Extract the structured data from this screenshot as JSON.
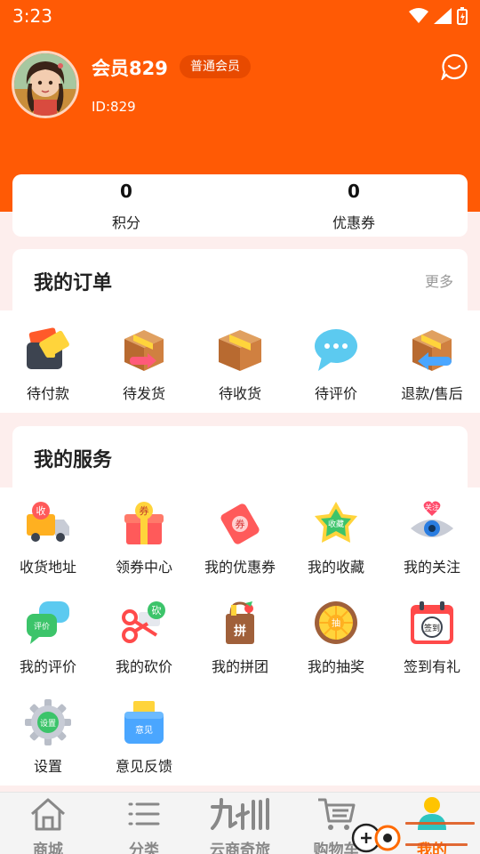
{
  "status": {
    "time": "3:23"
  },
  "profile": {
    "username": "会员829",
    "badge": "普通会员",
    "id_text": "ID:829"
  },
  "stats": [
    {
      "value": "0",
      "label": "积分"
    },
    {
      "value": "0",
      "label": "优惠券"
    }
  ],
  "orders": {
    "title": "我的订单",
    "more": "更多",
    "items": [
      {
        "label": "待付款",
        "icon": "wallet-icon"
      },
      {
        "label": "待发货",
        "icon": "box-send-icon"
      },
      {
        "label": "待收货",
        "icon": "box-icon"
      },
      {
        "label": "待评价",
        "icon": "chat-bubble-icon"
      },
      {
        "label": "退款/售后",
        "icon": "box-return-icon"
      }
    ]
  },
  "services": {
    "title": "我的服务",
    "items": [
      {
        "label": "收货地址",
        "icon": "delivery-truck-icon",
        "glyph": "收"
      },
      {
        "label": "领券中心",
        "icon": "gift-coupon-icon",
        "glyph": "券"
      },
      {
        "label": "我的优惠券",
        "icon": "ticket-icon",
        "glyph": "券"
      },
      {
        "label": "我的收藏",
        "icon": "favorite-icon",
        "glyph": "收藏"
      },
      {
        "label": "我的关注",
        "icon": "eye-follow-icon",
        "glyph": "关注"
      },
      {
        "label": "我的评价",
        "icon": "review-icon",
        "glyph": "评价"
      },
      {
        "label": "我的砍价",
        "icon": "scissors-icon",
        "glyph": "砍"
      },
      {
        "label": "我的拼团",
        "icon": "group-buy-icon",
        "glyph": "拼"
      },
      {
        "label": "我的抽奖",
        "icon": "lottery-icon",
        "glyph": "抽"
      },
      {
        "label": "签到有礼",
        "icon": "calendar-checkin-icon",
        "glyph": "签到"
      },
      {
        "label": "设置",
        "icon": "settings-gear-icon",
        "glyph": "设置"
      },
      {
        "label": "意见反馈",
        "icon": "feedback-icon",
        "glyph": "意见"
      }
    ]
  },
  "tabbar": [
    {
      "label": "商城",
      "icon": "home-icon"
    },
    {
      "label": "分类",
      "icon": "list-icon"
    },
    {
      "label": "云商奇旅",
      "icon": "jiuzhou-logo-icon"
    },
    {
      "label": "购物车",
      "icon": "cart-icon"
    },
    {
      "label": "我的",
      "icon": "user-icon"
    }
  ],
  "colors": {
    "brand": "#ff5a05",
    "page_bg": "#fdeeed",
    "active_tab": "#ff6a00"
  }
}
